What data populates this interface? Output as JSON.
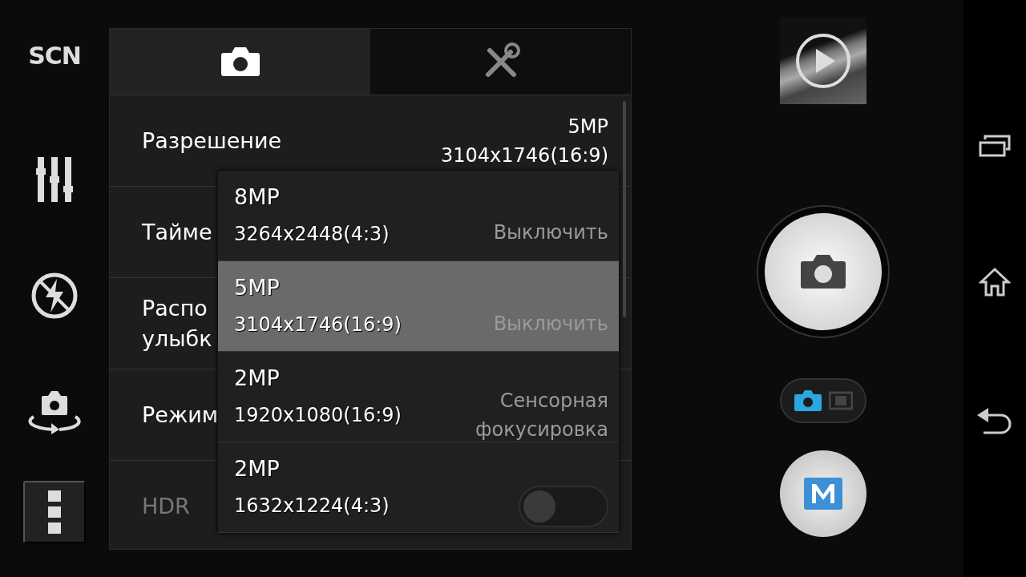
{
  "sidebar": {
    "scene_label": "SCN"
  },
  "settings_panel": {
    "tabs": [
      {
        "kind": "camera",
        "selected": true
      },
      {
        "kind": "tools",
        "selected": false
      }
    ],
    "rows": [
      {
        "kind": "value",
        "label": "Разрешение",
        "value_lines": [
          "5MP",
          "3104x1746(16:9)"
        ],
        "disabled": false
      },
      {
        "kind": "value",
        "label": "Тайме",
        "value_lines": [
          "Выключить"
        ],
        "disabled": false
      },
      {
        "kind": "value",
        "label": "Распо\nулыбк",
        "value_lines": [
          "Выключить"
        ],
        "disabled": false
      },
      {
        "kind": "value",
        "label": "Режим",
        "value_lines": [
          "Сенсорная",
          "фокусировка"
        ],
        "disabled": false
      },
      {
        "kind": "toggle",
        "label": "HDR",
        "on": false,
        "disabled": true
      }
    ]
  },
  "resolution_menu": {
    "options": [
      {
        "name": "8MP",
        "size": "3264x2448(4:3)",
        "selected": false
      },
      {
        "name": "5MP",
        "size": "3104x1746(16:9)",
        "selected": true
      },
      {
        "name": "2MP",
        "size": "1920x1080(16:9)",
        "selected": false
      },
      {
        "name": "2MP",
        "size": "1632x1224(4:3)",
        "selected": false
      }
    ]
  },
  "capture_mode": [
    {
      "kind": "photo",
      "selected": true
    },
    {
      "kind": "video",
      "selected": false
    }
  ]
}
